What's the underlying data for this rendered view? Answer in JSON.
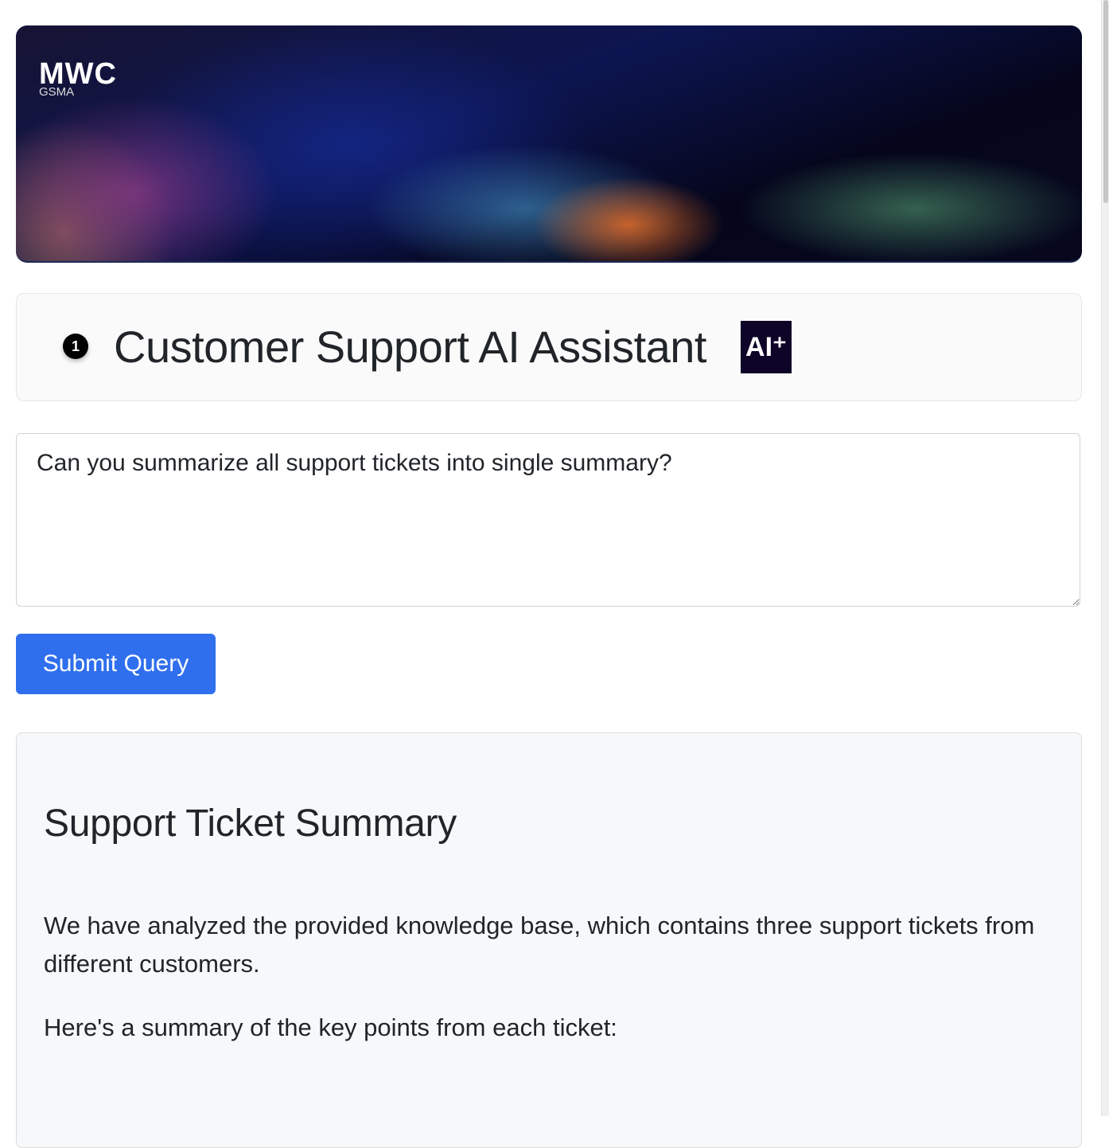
{
  "banner": {
    "logo_main": "MWC",
    "logo_sub": "GSMA"
  },
  "header": {
    "step_number": "1",
    "title": "Customer Support AI Assistant",
    "badge": "AI⁺"
  },
  "query": {
    "value": "Can you summarize all support tickets into single summary?"
  },
  "submit_label": "Submit Query",
  "response": {
    "heading": "Support Ticket Summary",
    "paragraphs": [
      "We have analyzed the provided knowledge base, which contains three support tickets from different customers.",
      "Here's a summary of the key points from each ticket:"
    ]
  }
}
